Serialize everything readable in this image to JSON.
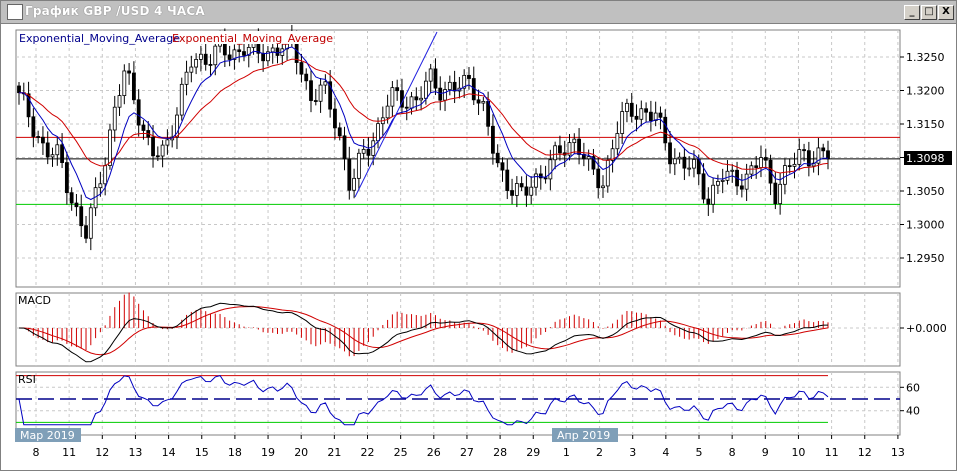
{
  "window": {
    "title": "График GBP /USD  4 ЧАСА",
    "minimize": "_",
    "maximize": "□",
    "close": "X"
  },
  "main": {
    "legend_fast": "Exponential_Moving_Average",
    "legend_slow": "Exponential_Moving_Average",
    "price_ticks": [
      "1.3250",
      "1.3200",
      "1.3150",
      "1.3100",
      "1.3050",
      "1.3000",
      "1.2950"
    ],
    "price_tick_values": [
      1.325,
      1.32,
      1.315,
      1.31,
      1.305,
      1.3,
      1.295
    ],
    "current_price": "1.3098",
    "current_price_value": 1.3098,
    "resistance_level": 1.313,
    "support_level": 1.303,
    "closes": [
      1.319,
      1.315,
      1.311,
      1.31,
      1.304,
      1.298,
      1.306,
      1.315,
      1.323,
      1.317,
      1.31,
      1.311,
      1.318,
      1.324,
      1.325,
      1.326,
      1.325,
      1.327,
      1.325,
      1.326,
      1.327,
      1.325,
      1.319,
      1.32,
      1.315,
      1.305,
      1.311,
      1.314,
      1.319,
      1.319,
      1.318,
      1.322,
      1.32,
      1.32,
      1.322,
      1.317,
      1.309,
      1.306,
      1.304,
      1.307,
      1.309,
      1.311,
      1.313,
      1.308,
      1.306,
      1.314,
      1.317,
      1.317,
      1.316,
      1.311,
      1.309,
      1.308,
      1.304,
      1.307,
      1.307,
      1.307,
      1.31,
      1.305,
      1.308,
      1.311,
      1.31,
      1.3098
    ],
    "colors": {
      "fast_ema": "#0000c0",
      "slow_ema": "#d00000",
      "resistance": "#d00000",
      "support": "#00cc00",
      "trendline": "#2020e0"
    }
  },
  "macd": {
    "label": "MACD",
    "zero_label": "+0.000"
  },
  "rsi": {
    "label": "RSI",
    "ticks": [
      "60",
      "40"
    ],
    "levels": [
      70,
      50,
      30
    ]
  },
  "xaxis": {
    "labels": [
      "8",
      "11",
      "12",
      "13",
      "14",
      "15",
      "18",
      "19",
      "20",
      "21",
      "22",
      "25",
      "26",
      "27",
      "28",
      "29",
      "1",
      "2",
      "3",
      "4",
      "5",
      "8",
      "9",
      "10",
      "11",
      "12",
      "13"
    ],
    "month_labels": [
      "Мар 2019",
      "Апр 2019"
    ]
  }
}
